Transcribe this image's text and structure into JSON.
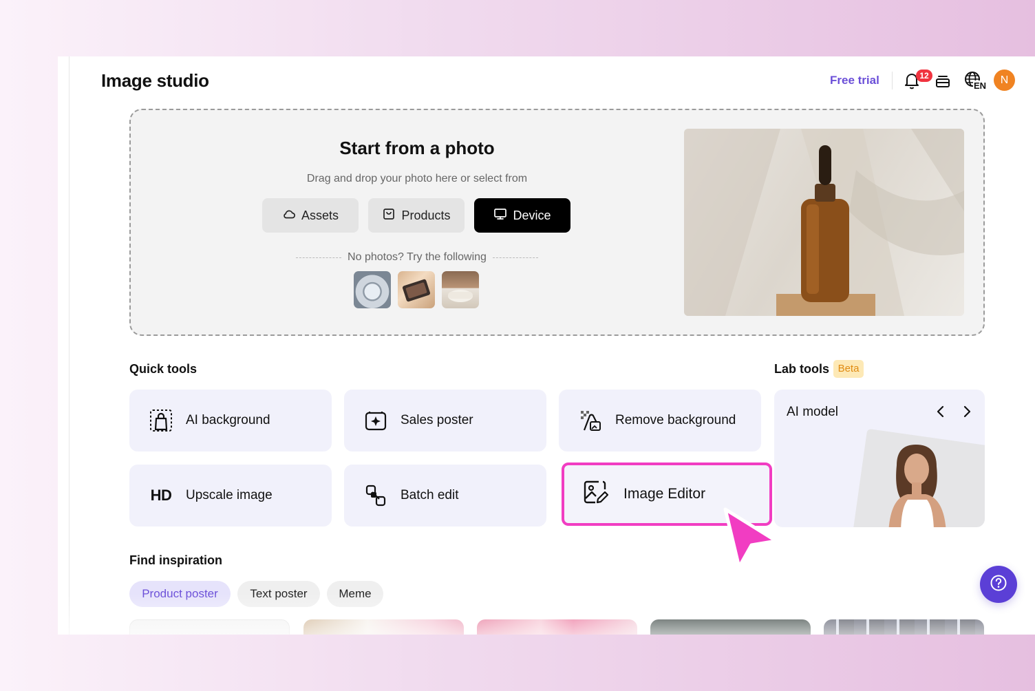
{
  "header": {
    "title": "Image studio",
    "free_trial": "Free trial",
    "notification_count": "12",
    "language_code": "EN",
    "avatar_initial": "N"
  },
  "upload": {
    "title": "Start from a photo",
    "subtitle": "Drag and drop your photo here or select from",
    "buttons": {
      "assets": "Assets",
      "products": "Products",
      "device": "Device"
    },
    "try_text": "No photos? Try the following"
  },
  "quick_tools": {
    "label": "Quick tools",
    "items": {
      "ai_background": "AI background",
      "sales_poster": "Sales poster",
      "remove_background": "Remove background",
      "upscale_icon_text": "HD",
      "upscale": "Upscale image",
      "batch_edit": "Batch edit",
      "image_editor": "Image Editor"
    }
  },
  "lab_tools": {
    "label": "Lab tools",
    "badge": "Beta",
    "card_title": "AI model"
  },
  "inspiration": {
    "label": "Find inspiration",
    "tabs": [
      "Product poster",
      "Text poster",
      "Meme"
    ],
    "active_tab": "Product poster"
  },
  "colors": {
    "accent": "#6b4fd8",
    "highlight": "#f13dc2",
    "badge": "#f0333f",
    "avatar": "#f08322",
    "beta_bg": "#fde9b6",
    "beta_text": "#e08b12"
  },
  "icons": [
    "bell-icon",
    "layers-icon",
    "globe-icon",
    "cloud-icon",
    "product-box-icon",
    "monitor-icon",
    "ai-background-icon",
    "sales-poster-icon",
    "remove-background-icon",
    "batch-edit-icon",
    "image-editor-icon",
    "chevron-left-icon",
    "chevron-right-icon",
    "help-icon"
  ]
}
